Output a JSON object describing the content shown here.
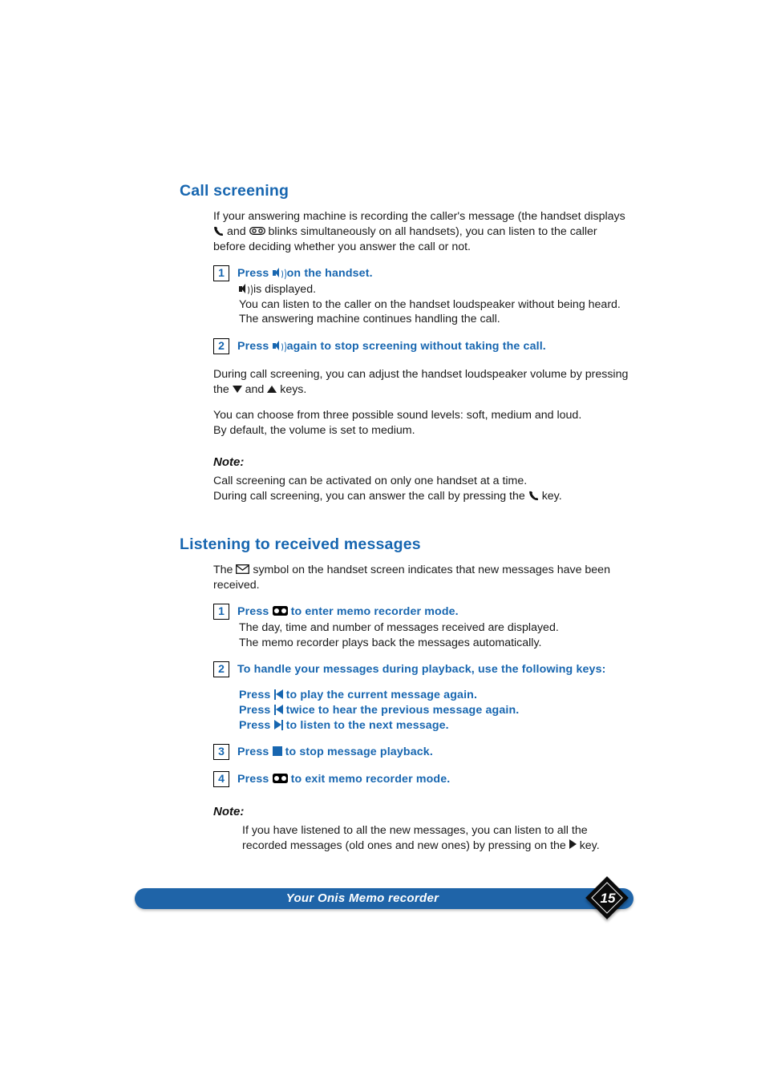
{
  "document": {
    "page_number": "15",
    "footer_title": "Your Onis Memo recorder"
  },
  "sections": [
    {
      "id": "call-screening",
      "title": "Call screening",
      "intro_line1": "If your answering machine is recording the caller's message (the handset displays",
      "intro_line2_a": "and",
      "intro_line2_b": "blinks simultaneously on all handsets), you can listen to the caller",
      "intro_line3": "before deciding whether you answer the call or not.",
      "steps": [
        {
          "number": "1",
          "head_before": "Press",
          "head_after": "on the handset.",
          "icon": "speaker-icon",
          "sub_lines": [
            "is displayed.",
            "You can listen to the caller on the handset loudspeaker without being heard.",
            "The answering machine continues handling the call."
          ]
        },
        {
          "number": "2",
          "head_before": "Press",
          "head_after": "again to stop screening without taking the call.",
          "icon": "speaker-icon",
          "sub_lines": []
        }
      ],
      "volume_line1": "During call screening, you can adjust the handset loudspeaker volume by pressing",
      "volume_line2_a": "the",
      "volume_line2_b": "and",
      "volume_line2_c": "keys.",
      "levels_line1": "You can choose from three possible sound levels: soft, medium and loud.",
      "levels_line2": "By default, the volume is set to medium.",
      "note_label": "Note:",
      "note_line1": "Call screening can be activated on only one handset at a time.",
      "note_line2_a": "During call screening, you can answer the call by pressing the",
      "note_line2_b": "key."
    },
    {
      "id": "listening-to-received-messages",
      "title": "Listening to received messages",
      "intro_line1_a": "The",
      "intro_line1_b": "symbol on the handset screen indicates that new messages have been",
      "intro_line2": "received.",
      "steps": [
        {
          "number": "1",
          "head_before": "Press",
          "head_after": "to enter memo recorder mode.",
          "icon": "cassette-icon",
          "sub_lines": [
            "The day, time and number of messages received are displayed.",
            "The memo recorder plays back the messages automatically."
          ]
        },
        {
          "number": "2",
          "head_full": "To handle your messages during playback, use the following keys:",
          "key_lines": [
            {
              "before": "Press",
              "after": "to play the current message again.",
              "icon": "previous-track-icon"
            },
            {
              "before": "Press",
              "after": "twice to hear the previous message again.",
              "icon": "previous-track-icon"
            },
            {
              "before": "Press",
              "after": "to listen to the next message.",
              "icon": "next-track-icon"
            }
          ]
        },
        {
          "number": "3",
          "head_before": "Press",
          "head_after": "to stop message playback.",
          "icon": "stop-icon"
        },
        {
          "number": "4",
          "head_before": "Press",
          "head_after": "to exit memo recorder mode.",
          "icon": "cassette-icon"
        }
      ],
      "note_label": "Note:",
      "note_line1": "If you have listened to all the new messages, you can listen to all the",
      "note_line2_a": "recorded messages (old ones and new ones) by pressing  on the",
      "note_line2_b": "key."
    }
  ],
  "colors": {
    "heading_blue": "#1766b0",
    "footer_blue": "#1f64a8",
    "badge_black": "#0a0a0a",
    "body_text": "#1a1a1a"
  }
}
